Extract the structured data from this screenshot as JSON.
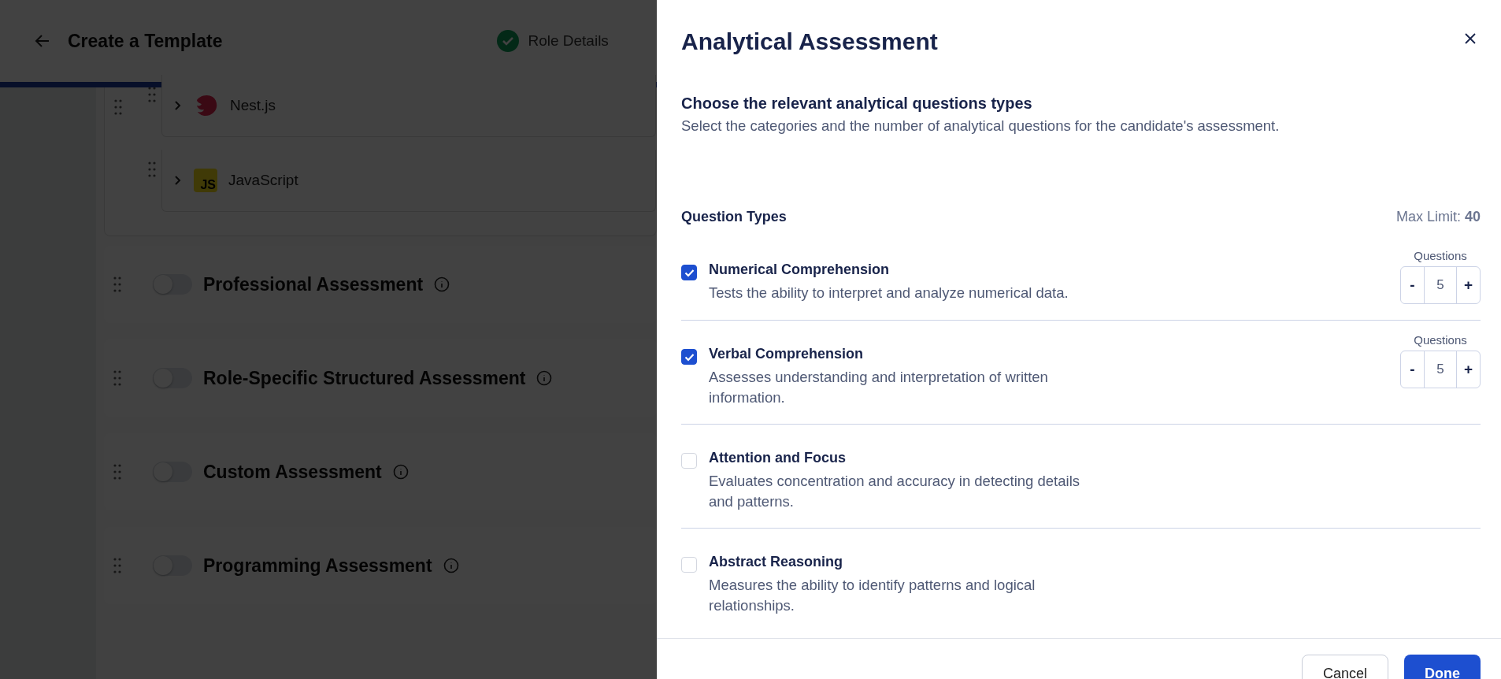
{
  "page": {
    "title": "Create a Template",
    "steps": [
      {
        "label": "Role Details",
        "done": true
      }
    ]
  },
  "skills": [
    {
      "name": "Nest.js",
      "kind": "nest"
    },
    {
      "name": "JavaScript",
      "kind": "js",
      "icon_text": "JS"
    }
  ],
  "sections": [
    {
      "title": "Professional Assessment",
      "on": false
    },
    {
      "title": "Role-Specific Structured Assessment",
      "on": false
    },
    {
      "title": "Custom Assessment",
      "on": false
    },
    {
      "title": "Programming Assessment",
      "on": false
    }
  ],
  "drawer": {
    "title": "Analytical Assessment",
    "heading": "Choose the relevant analytical questions types",
    "description": "Select the categories and the number of analytical questions for the candidate's assessment.",
    "list_title": "Question Types",
    "max_limit_label": "Max Limit:",
    "max_limit": "40",
    "question_types": [
      {
        "name": "Numerical Comprehension",
        "description": "Tests the ability to interpret and analyze numerical data.",
        "checked": true,
        "questions_label": "Questions",
        "count": "5",
        "minus": "-",
        "plus": "+"
      },
      {
        "name": "Verbal Comprehension",
        "description": "Assesses understanding and interpretation of written information.",
        "checked": true,
        "questions_label": "Questions",
        "count": "5",
        "minus": "-",
        "plus": "+"
      },
      {
        "name": "Attention and Focus",
        "description": "Evaluates concentration and accuracy in detecting details and patterns.",
        "checked": false
      },
      {
        "name": "Abstract Reasoning",
        "description": "Measures the ability to identify patterns and logical relationships.",
        "checked": false
      }
    ],
    "cancel": "Cancel",
    "done": "Done"
  }
}
